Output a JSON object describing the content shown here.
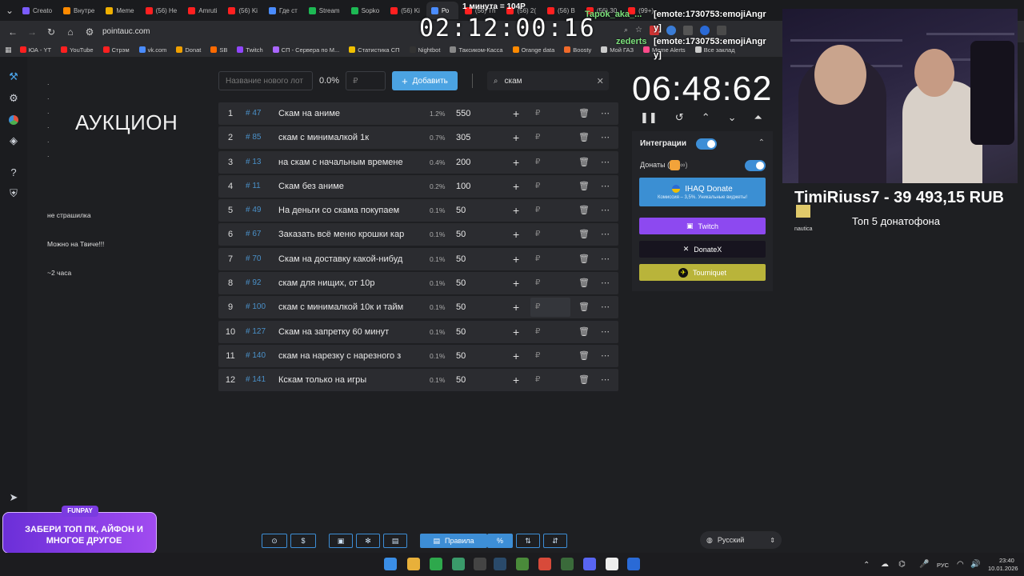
{
  "browser": {
    "tabs": [
      {
        "label": "Creato",
        "color": "#7b5cff"
      },
      {
        "label": "Внутре",
        "color": "#ff8a00"
      },
      {
        "label": "Meme",
        "color": "#f0b000"
      },
      {
        "label": "(56) He",
        "color": "#ff2020"
      },
      {
        "label": "Amruti",
        "color": "#ff2020"
      },
      {
        "label": "(56) Ki",
        "color": "#ff2020"
      },
      {
        "label": "Где ст",
        "color": "#4a8cff"
      },
      {
        "label": "Stream",
        "color": "#1db954"
      },
      {
        "label": "Sopko",
        "color": "#1db954"
      },
      {
        "label": "(56) Ki",
        "color": "#ff2020"
      },
      {
        "label": "Ро",
        "color": "#4a8cff"
      },
      {
        "label": "(56) Th",
        "color": "#ff2020"
      },
      {
        "label": "(56) 2(",
        "color": "#ff2020"
      },
      {
        "label": "(56) B",
        "color": "#ff2020"
      },
      {
        "label": "(56) 30",
        "color": "#ff2020"
      },
      {
        "label": "(99+)",
        "color": "#ff2020"
      }
    ],
    "url": "pointauc.com",
    "bookmarks": [
      {
        "label": "ЮА - YT",
        "color": "#ff2020"
      },
      {
        "label": "YouTube",
        "color": "#ff2020"
      },
      {
        "label": "Стрэм",
        "color": "#ff2020"
      },
      {
        "label": "vk.com",
        "color": "#4a8cff"
      },
      {
        "label": "Donat",
        "color": "#f0a000"
      },
      {
        "label": "SB",
        "color": "#ff6a00"
      },
      {
        "label": "Twitch",
        "color": "#9146ff"
      },
      {
        "label": "СП - Сервера по М...",
        "color": "#aa66ff"
      },
      {
        "label": "Статистика СП",
        "color": "#f0c000"
      },
      {
        "label": "Nightbot",
        "color": "#333"
      },
      {
        "label": "Таксиком-Касса",
        "color": "#888"
      },
      {
        "label": "Orange data",
        "color": "#ff8a00"
      },
      {
        "label": "Boosty",
        "color": "#f06a2a"
      },
      {
        "label": "Мой ГАЗ",
        "color": "#ccc"
      },
      {
        "label": "Meme Alerts",
        "color": "#ff4a8a"
      },
      {
        "label": "Все заклад",
        "color": "#ccc"
      }
    ]
  },
  "sidebar": {
    "title": "АУКЦИОН",
    "lines": [
      "не страшилка",
      "Можно на  Твиче!!!",
      "~2 часа"
    ]
  },
  "controls": {
    "new_lot_placeholder": "Название нового лот",
    "percent": "0.0%",
    "currency": "₽",
    "add_label": "Добавить",
    "search_value": "скам"
  },
  "lots": [
    {
      "n": "1",
      "id": "# 47",
      "name": "Скам на аниме",
      "pct": "1.2%",
      "amount": "550"
    },
    {
      "n": "2",
      "id": "# 85",
      "name": "скам с минималкой 1к",
      "pct": "0.7%",
      "amount": "305"
    },
    {
      "n": "3",
      "id": "# 13",
      "name": "на скам с начальным времене",
      "pct": "0.4%",
      "amount": "200"
    },
    {
      "n": "4",
      "id": "# 11",
      "name": "Скам без аниме",
      "pct": "0.2%",
      "amount": "100"
    },
    {
      "n": "5",
      "id": "# 49",
      "name": "На деньги со скама покупаем",
      "pct": "0.1%",
      "amount": "50"
    },
    {
      "n": "6",
      "id": "# 67",
      "name": "Заказать всё меню крошки кар",
      "pct": "0.1%",
      "amount": "50"
    },
    {
      "n": "7",
      "id": "# 70",
      "name": "Скам на доставку какой-нибуд",
      "pct": "0.1%",
      "amount": "50"
    },
    {
      "n": "8",
      "id": "# 92",
      "name": "скам для нищих, от 10р",
      "pct": "0.1%",
      "amount": "50"
    },
    {
      "n": "9",
      "id": "# 100",
      "name": " скам с минималкой 10к и тайм",
      "pct": "0.1%",
      "amount": "50"
    },
    {
      "n": "10",
      "id": "# 127",
      "name": "Скам на запретку 60 минут",
      "pct": "0.1%",
      "amount": "50"
    },
    {
      "n": "11",
      "id": "# 140",
      "name": " скам на нарезку с нарезного з",
      "pct": "0.1%",
      "amount": "50"
    },
    {
      "n": "12",
      "id": "# 141",
      "name": "Кскам только на игры",
      "pct": "0.1%",
      "amount": "50"
    }
  ],
  "timer": "06:48:62",
  "integrations": {
    "title": "Интеграции",
    "donations_label": "Донаты (",
    "ihaq_title": "IHAQ Donate",
    "ihaq_sub": "Комиссия – 3,5%. Уникальные виджеты!",
    "twitch": "Twitch",
    "donatex": "DonateX",
    "tourniquet": "Tourniquet"
  },
  "bottom_bar": {
    "rules": "Правила",
    "language": "Русский"
  },
  "overlay": {
    "top_note": "1 минута = 104Р",
    "clock": "02:12:00:16",
    "chat": [
      {
        "text": "Tapok_aka_...",
        "color": "#7be07b"
      },
      {
        "text": "[emote:1730753:emojiAngr",
        "color": "#ffffff"
      },
      {
        "text": "y]",
        "color": "#ffffff"
      },
      {
        "text": "zederts",
        "color": "#7be07b"
      },
      {
        "text": "[emote:1730753:emojiAngr",
        "color": "#ffffff"
      },
      {
        "text": "y]",
        "color": "#ffffff"
      }
    ],
    "stats": "TimiRiuss7 - 39 493,15 RUB",
    "top_label": "Топ  5 донатофона",
    "small_label": "nautica",
    "banner_badge": "FUNPAY",
    "banner_text": "ЗАБЕРИ ТОП ПК, АЙФОН И МНОГОЕ ДРУГОЕ"
  },
  "taskbar": {
    "lang": "РУС",
    "time": "23:40",
    "date": "10.01.2026"
  }
}
